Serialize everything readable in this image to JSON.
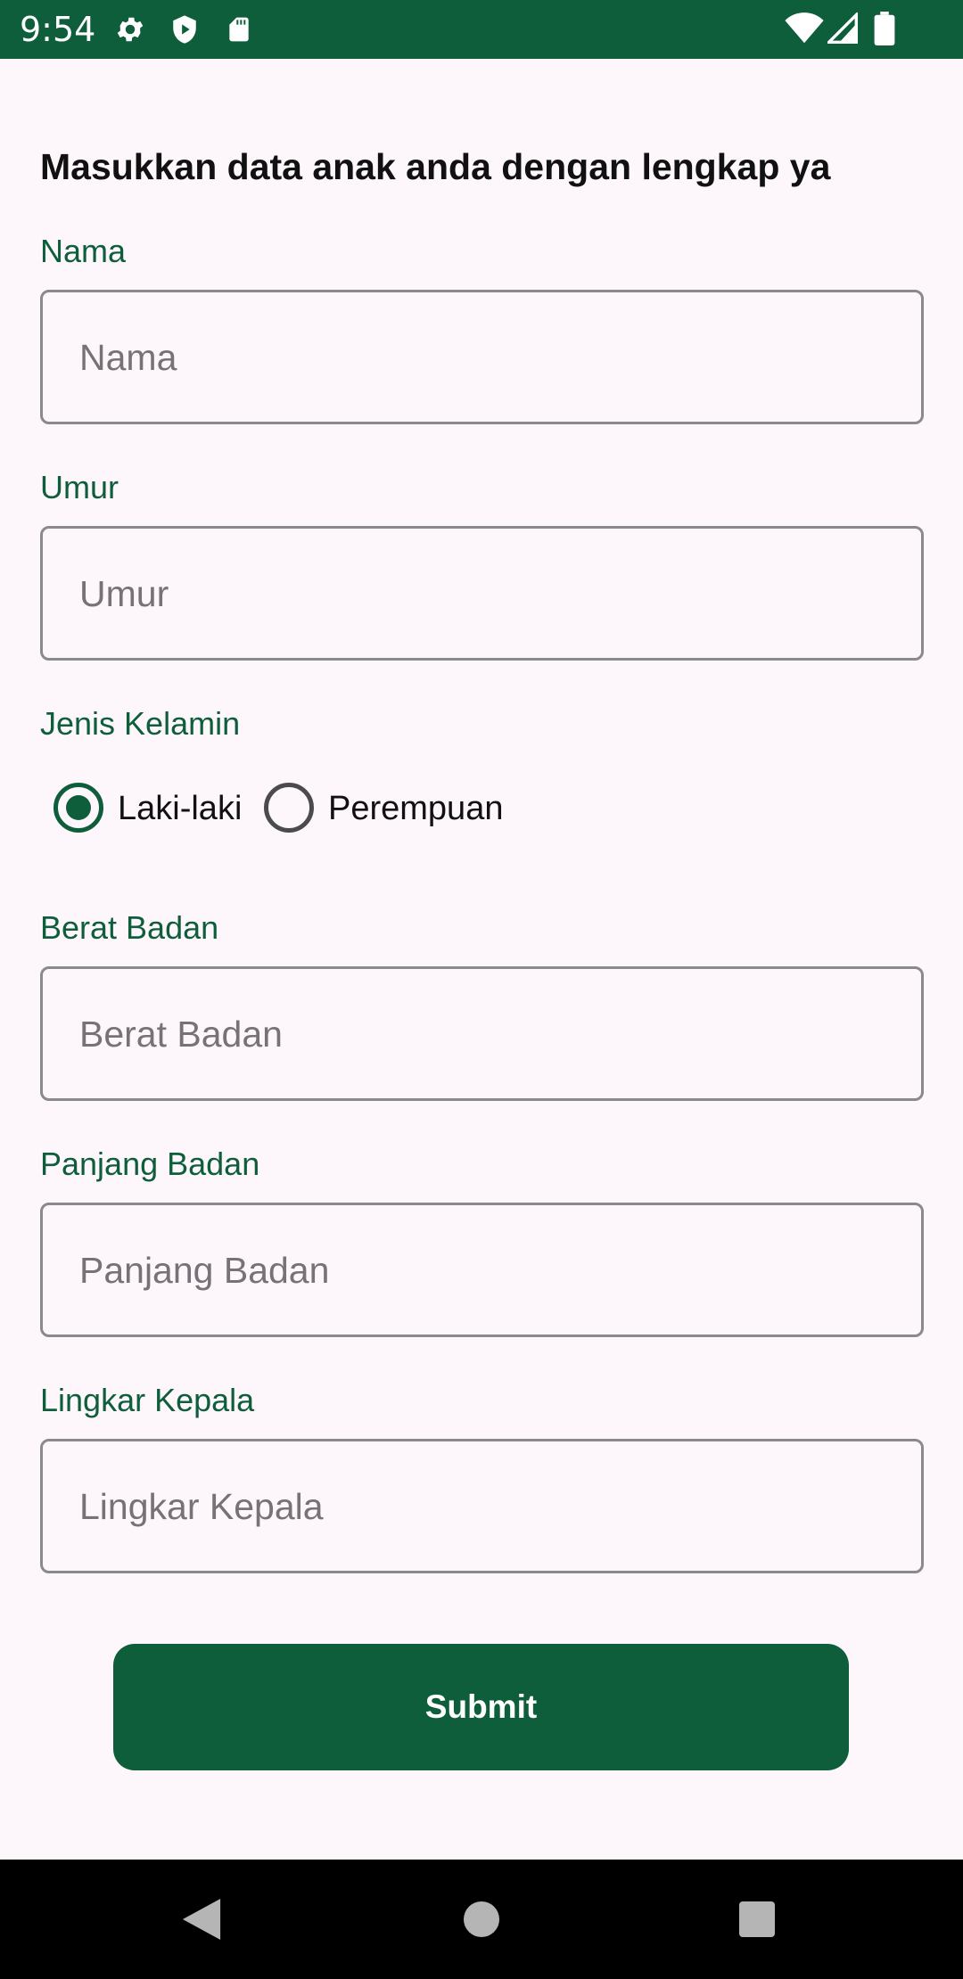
{
  "status_bar": {
    "time": "9:54",
    "icons": [
      "gear-icon",
      "shield-icon",
      "sd-card-icon",
      "wifi-icon",
      "signal-icon",
      "battery-icon"
    ],
    "background": "#0e5e3b"
  },
  "form": {
    "heading": "Masukkan data anak anda dengan lengkap ya",
    "nama": {
      "label": "Nama",
      "placeholder": "Nama",
      "value": ""
    },
    "umur": {
      "label": "Umur",
      "placeholder": "Umur",
      "value": ""
    },
    "jenis_kelamin": {
      "label": "Jenis Kelamin",
      "options": [
        "Laki-laki",
        "Perempuan"
      ],
      "selected": "Laki-laki"
    },
    "berat_badan": {
      "label": "Berat Badan",
      "placeholder": "Berat Badan",
      "value": ""
    },
    "panjang_badan": {
      "label": "Panjang Badan",
      "placeholder": "Panjang Badan",
      "value": ""
    },
    "lingkar_kepala": {
      "label": "Lingkar Kepala",
      "placeholder": "Lingkar Kepala",
      "value": ""
    },
    "submit_label": "Submit"
  },
  "nav_bar": {
    "icons": [
      "back-icon",
      "home-icon",
      "recents-icon"
    ]
  },
  "colors": {
    "accent": "#0e5e3b",
    "background": "#fdf7fc",
    "field_border": "#8a8a8a"
  }
}
